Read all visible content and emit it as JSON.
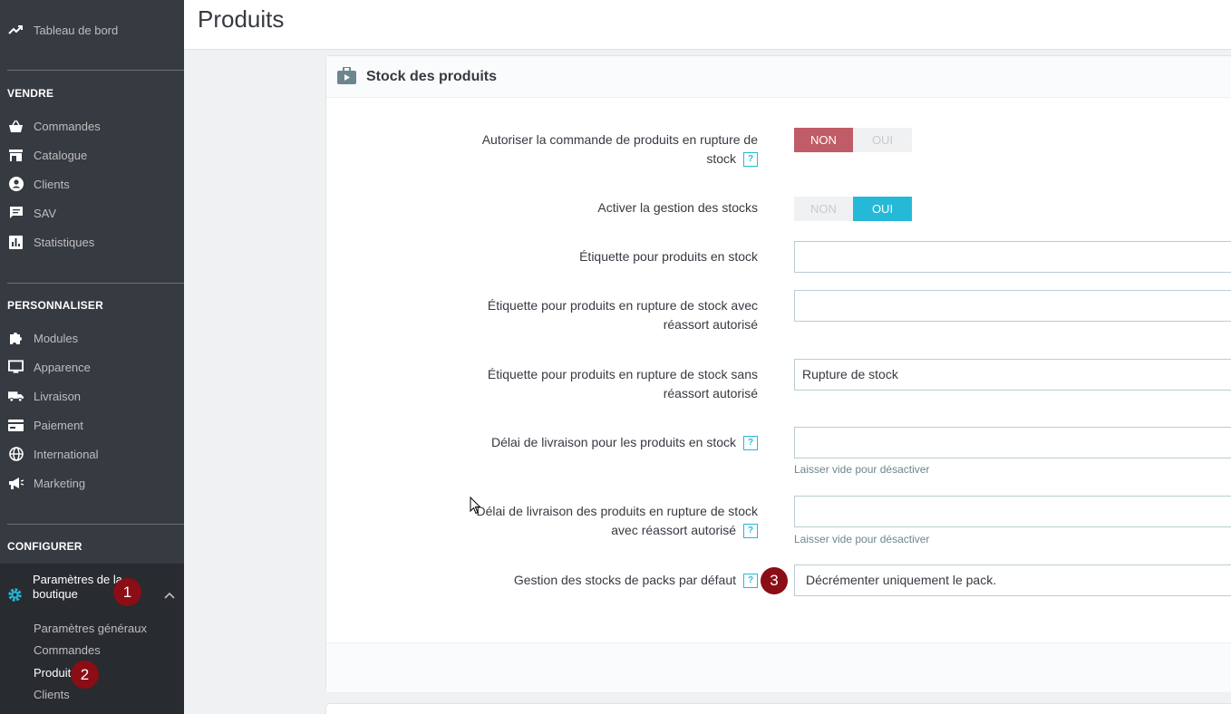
{
  "sidebar": {
    "dashboard": "Tableau de bord",
    "sections": {
      "sell": "VENDRE",
      "customize": "PERSONNALISER",
      "configure": "CONFIGURER"
    },
    "sell_items": [
      "Commandes",
      "Catalogue",
      "Clients",
      "SAV",
      "Statistiques"
    ],
    "customize_items": [
      "Modules",
      "Apparence",
      "Livraison",
      "Paiement",
      "International",
      "Marketing"
    ],
    "shop_params": "Paramètres de la boutique",
    "sub_items": [
      "Paramètres généraux",
      "Commandes",
      "Produits",
      "Clients"
    ],
    "badges": [
      "1",
      "2"
    ]
  },
  "header": {
    "title": "Produits"
  },
  "panel": {
    "title": "Stock des produits",
    "fields": {
      "allow_oos_order": {
        "label": "Autoriser la commande de produits en rupture de stock",
        "non": "NON",
        "oui": "OUI",
        "value": "NON"
      },
      "stock_management": {
        "label": "Activer la gestion des stocks",
        "non": "NON",
        "oui": "OUI",
        "value": "OUI"
      },
      "label_in_stock": {
        "label": "Étiquette pour produits en stock",
        "value": ""
      },
      "label_oos_allowed": {
        "label": "Étiquette pour produits en rupture de stock avec réassort autorisé",
        "value": ""
      },
      "label_oos_denied": {
        "label": "Étiquette pour produits en rupture de stock sans réassort autorisé",
        "value": "Rupture de stock"
      },
      "delivery_in_stock": {
        "label": "Délai de livraison pour les produits en stock",
        "value": "",
        "hint": "Laisser vide pour désactiver"
      },
      "delivery_oos": {
        "label": "Délai de livraison des produits en rupture de stock avec réassort autorisé",
        "value": "",
        "hint": "Laisser vide pour désactiver"
      },
      "pack_stock": {
        "label": "Gestion des stocks de packs par défaut",
        "value": "Décrémenter uniquement le pack.",
        "badge": "3"
      }
    },
    "help_glyph": "?"
  },
  "colors": {
    "sidebar_bg": "#363a41",
    "accent": "#25b9d7",
    "non_active": "#c05c67",
    "badge": "#8b0d15"
  }
}
